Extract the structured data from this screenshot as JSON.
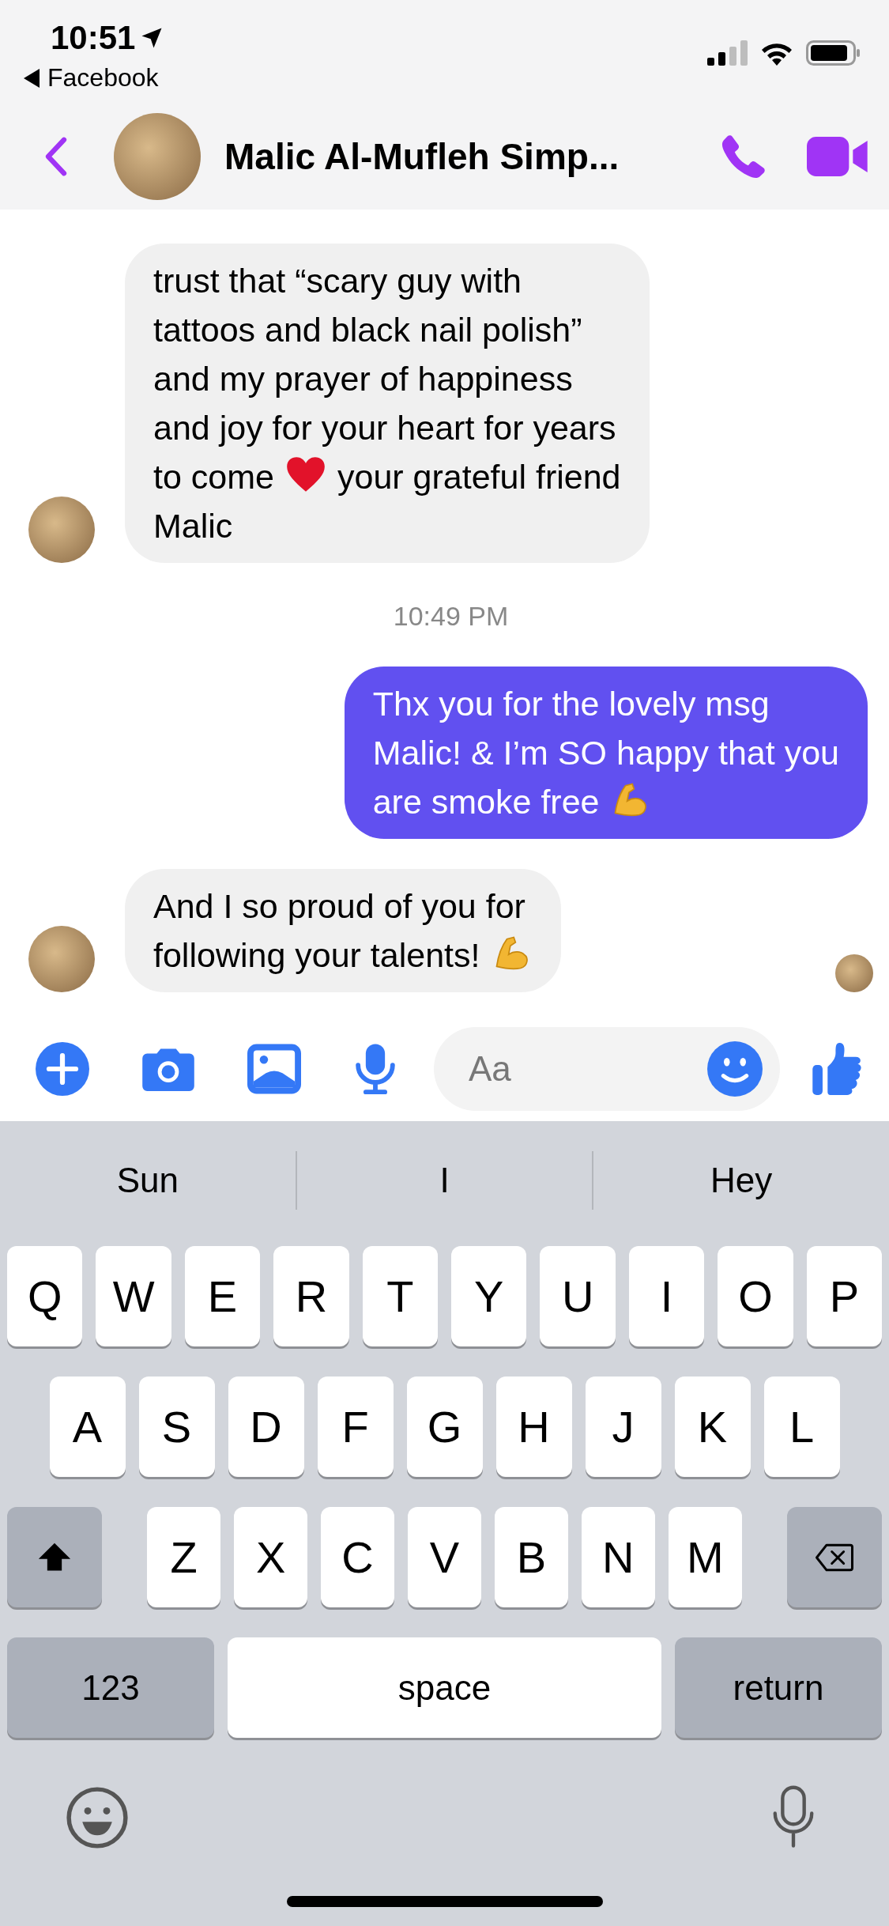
{
  "status_bar": {
    "time": "10:51",
    "back_app": "Facebook"
  },
  "header": {
    "name": "Malic Al-Mufleh Simp..."
  },
  "messages": [
    {
      "kind": "incoming",
      "avatar": true,
      "seen": false,
      "lines": [
        [
          {
            "kind": "text",
            "text": "trust that “scary guy with"
          }
        ],
        [
          {
            "kind": "text",
            "text": "tattoos and black nail polish”"
          }
        ],
        [
          {
            "kind": "text",
            "text": "and my prayer of happiness"
          }
        ],
        [
          {
            "kind": "text",
            "text": "and joy for your heart for years"
          }
        ],
        [
          {
            "kind": "text",
            "text": "to come"
          },
          {
            "kind": "heart"
          },
          {
            "kind": "text",
            "text": "your grateful friend"
          }
        ],
        [
          {
            "kind": "text",
            "text": "Malic"
          }
        ]
      ]
    },
    {
      "kind": "timestamp",
      "text": "10:49 PM"
    },
    {
      "kind": "outgoing",
      "lines": [
        [
          {
            "kind": "text",
            "text": "Thx you for the lovely msg"
          }
        ],
        [
          {
            "kind": "text",
            "text": "Malic! & I’m SO happy that you"
          }
        ],
        [
          {
            "kind": "text",
            "text": "are smoke free"
          },
          {
            "kind": "muscle"
          }
        ]
      ]
    },
    {
      "kind": "incoming",
      "avatar": true,
      "seen": true,
      "lines": [
        [
          {
            "kind": "text",
            "text": "And I so proud of you for"
          }
        ],
        [
          {
            "kind": "text",
            "text": "following your talents!"
          },
          {
            "kind": "muscle"
          }
        ]
      ]
    }
  ],
  "composer": {
    "placeholder": "Aa"
  },
  "keyboard": {
    "suggestions": [
      "Sun",
      "I",
      "Hey"
    ],
    "rows": [
      [
        "Q",
        "W",
        "E",
        "R",
        "T",
        "Y",
        "U",
        "I",
        "O",
        "P"
      ],
      [
        "A",
        "S",
        "D",
        "F",
        "G",
        "H",
        "J",
        "K",
        "L"
      ],
      [
        "Z",
        "X",
        "C",
        "V",
        "B",
        "N",
        "M"
      ]
    ],
    "bottom_row": [
      {
        "kind": "mode",
        "label": "123"
      },
      {
        "kind": "space",
        "label": "space"
      },
      {
        "kind": "return",
        "label": "return"
      }
    ]
  }
}
